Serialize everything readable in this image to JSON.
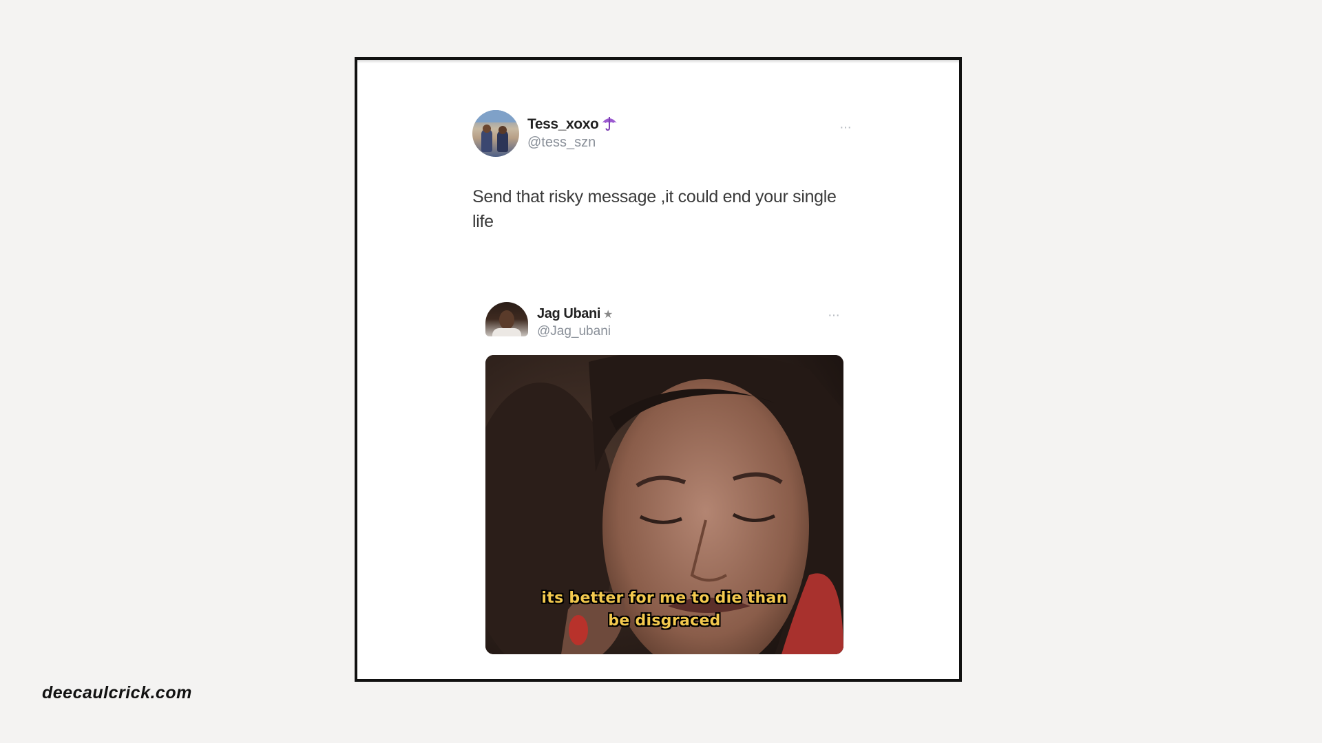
{
  "tweet": {
    "display_name": "Tess_xoxo",
    "badge_icon": "umbrella-icon",
    "handle": "@tess_szn",
    "more_label": "···",
    "text": "Send that risky message ,it could end your single life"
  },
  "quoted_tweet": {
    "display_name": "Jag Ubani",
    "badge": "★",
    "handle": "@Jag_ubani",
    "more_label": "···",
    "media": {
      "icon": "crying-woman-image",
      "caption_line1": "its better for me to die than",
      "caption_line2": "be disgraced",
      "caption_color": "#f3c94e"
    }
  },
  "watermark": "deecaulcrick.com",
  "colors": {
    "background": "#f4f3f2",
    "card": "#ffffff",
    "card_border": "#111111",
    "umbrella": "#9b59d0"
  }
}
